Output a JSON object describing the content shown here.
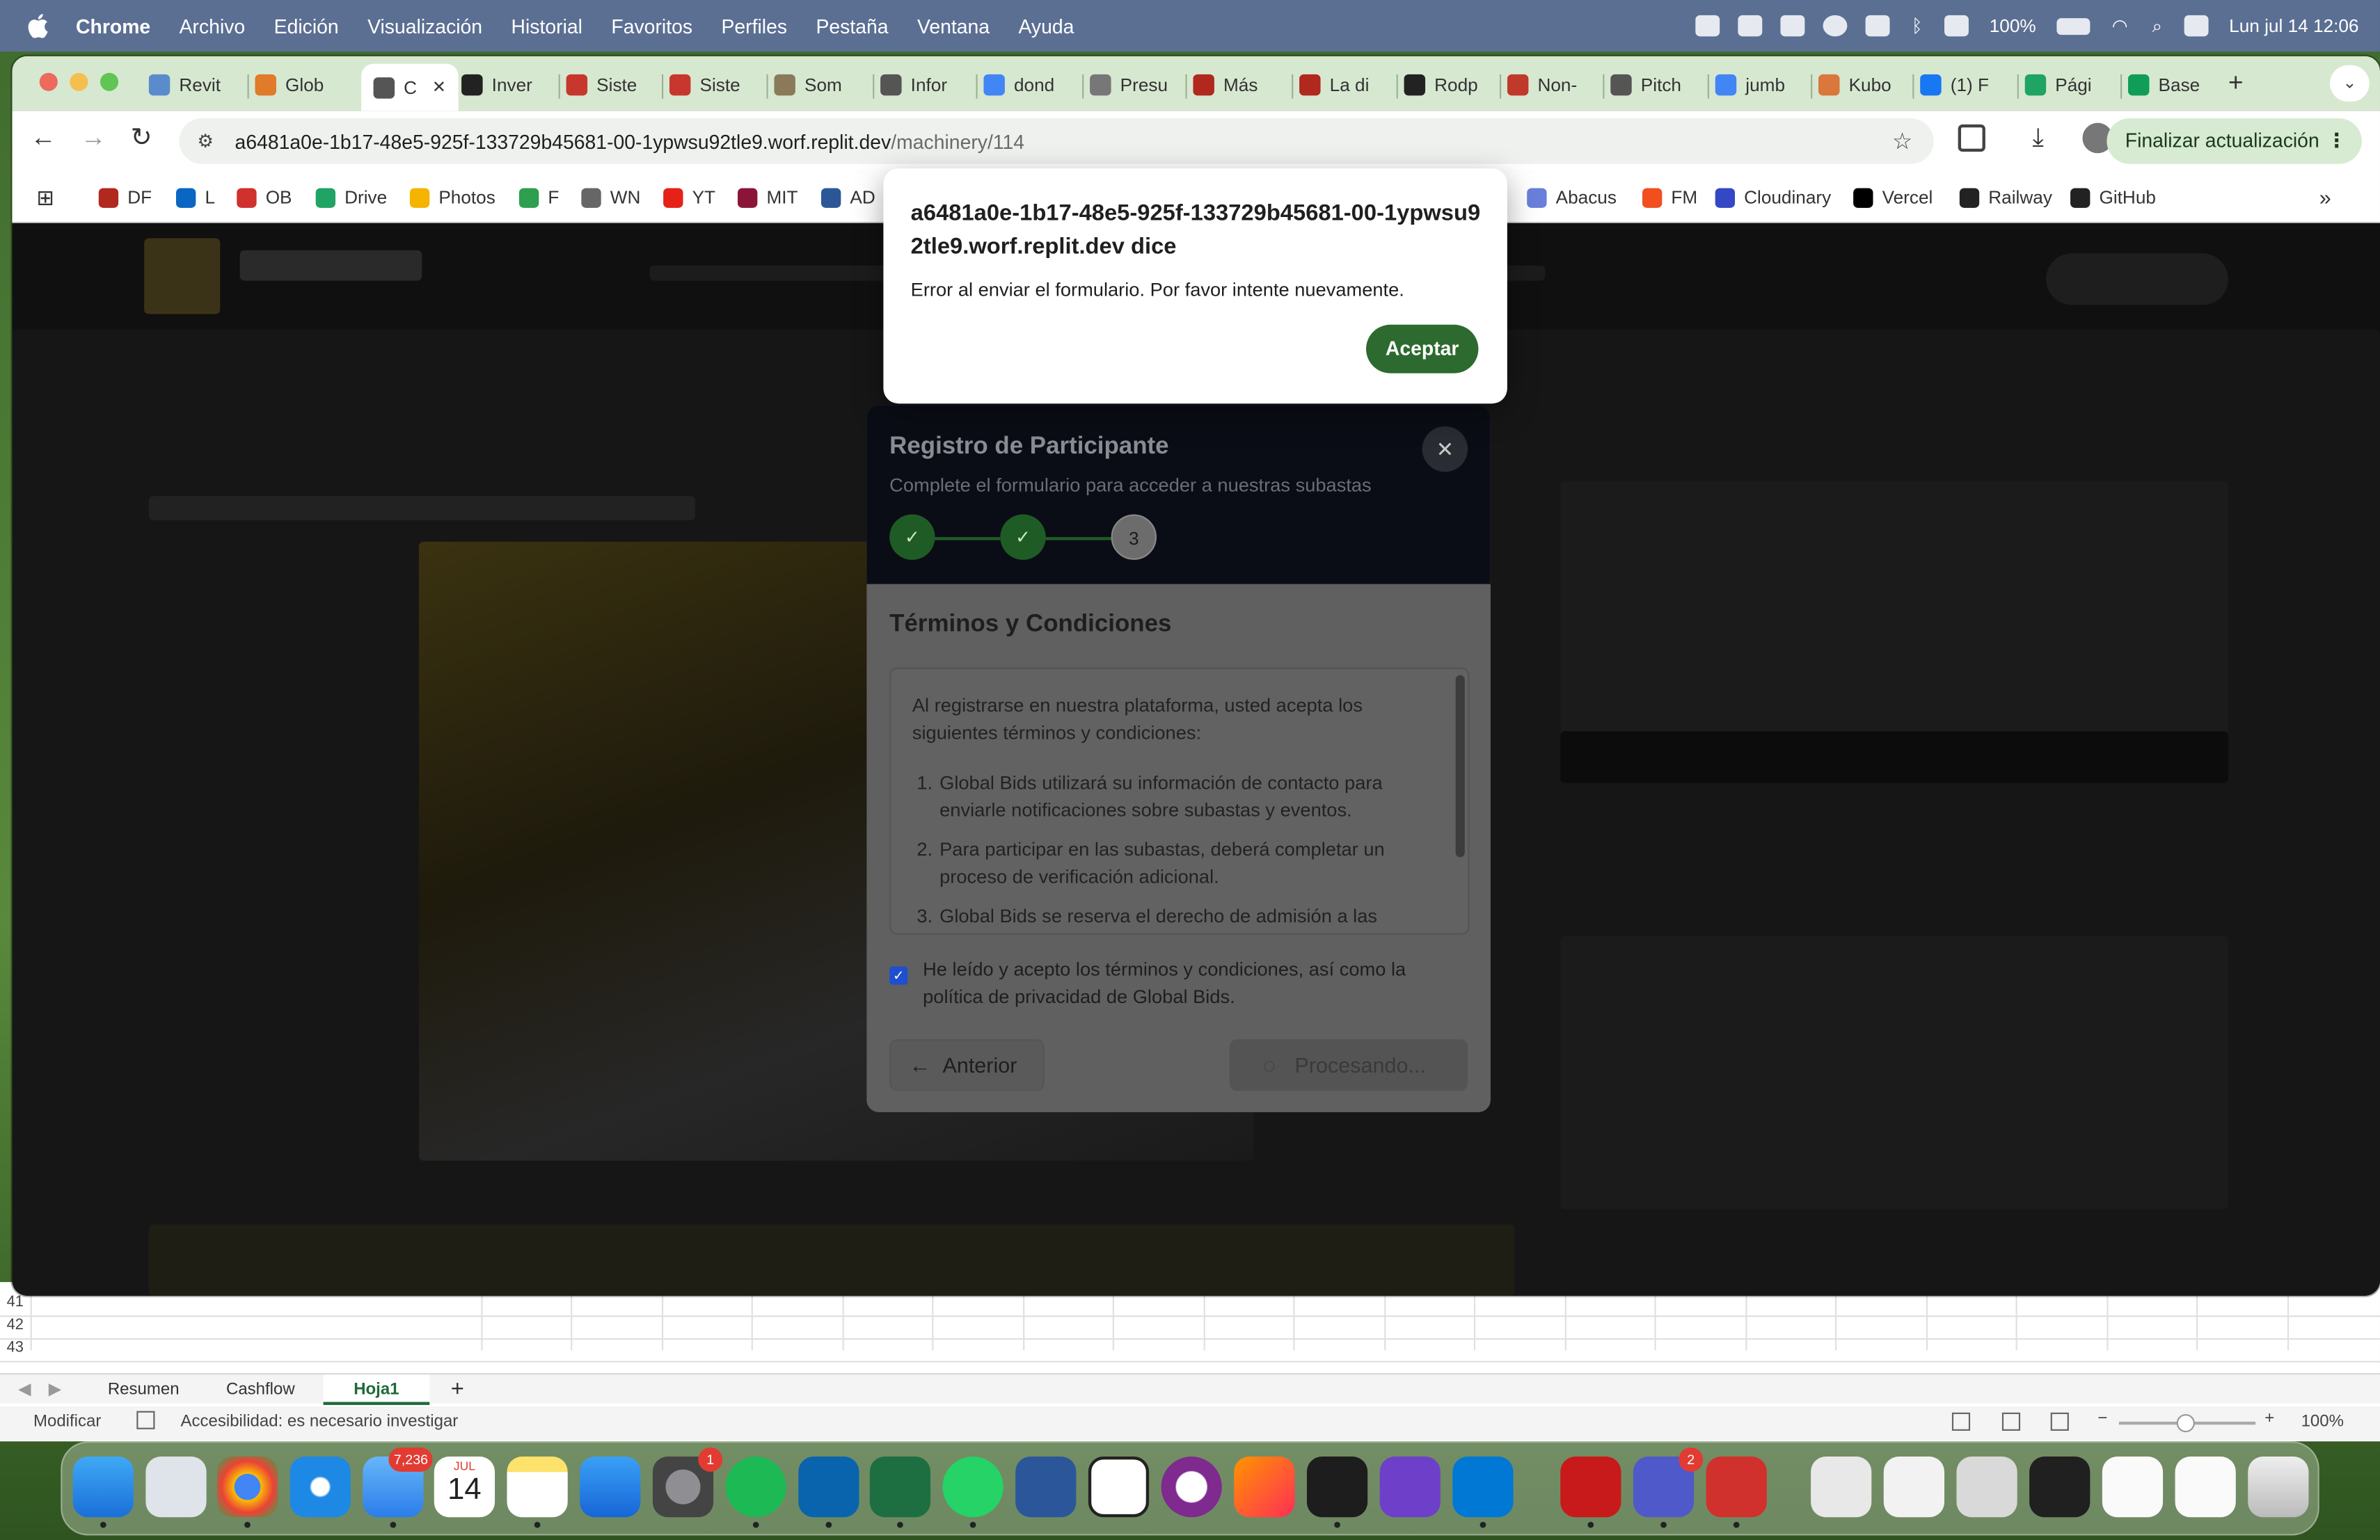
{
  "menubar": {
    "app": "Chrome",
    "items": [
      "Archivo",
      "Edición",
      "Visualización",
      "Historial",
      "Favoritos",
      "Perfiles",
      "Pestaña",
      "Ventana",
      "Ayuda"
    ],
    "battery": "100%",
    "clock": "Lun jul 14  12:06"
  },
  "tabs": [
    {
      "label": "Revit",
      "icon": "revit-icon",
      "color": "#5a8ccc"
    },
    {
      "label": "Glob",
      "icon": "global-bids-icon",
      "color": "#e07b2a"
    },
    {
      "label": "C",
      "icon": "globe-icon",
      "color": "#555555",
      "active": true
    },
    {
      "label": "Inver",
      "icon": "openai-icon",
      "color": "#222222"
    },
    {
      "label": "Siste",
      "icon": "flag-icon",
      "color": "#c8372d"
    },
    {
      "label": "Siste",
      "icon": "flag-icon",
      "color": "#c8372d"
    },
    {
      "label": "Som",
      "icon": "hat-icon",
      "color": "#8a7a5a"
    },
    {
      "label": "Infor",
      "icon": "globe-icon",
      "color": "#555555"
    },
    {
      "label": "dond",
      "icon": "google-icon",
      "color": "#4285f4"
    },
    {
      "label": "Presu",
      "icon": "loader-icon",
      "color": "#777777"
    },
    {
      "label": "Más",
      "icon": "df-icon",
      "color": "#b1281e"
    },
    {
      "label": "La di",
      "icon": "df-icon",
      "color": "#b1281e"
    },
    {
      "label": "Rodp",
      "icon": "github-icon",
      "color": "#222222"
    },
    {
      "label": "Non-",
      "icon": "r-icon",
      "color": "#c0392b"
    },
    {
      "label": "Pitch",
      "icon": "globe-icon",
      "color": "#555555"
    },
    {
      "label": "jumb",
      "icon": "google-icon",
      "color": "#4285f4"
    },
    {
      "label": "Kubo",
      "icon": "claude-icon",
      "color": "#d9773c"
    },
    {
      "label": "(1) F",
      "icon": "facebook-icon",
      "color": "#1877f2"
    },
    {
      "label": "Pági",
      "icon": "drive-icon",
      "color": "#1fa463"
    },
    {
      "label": "Base",
      "icon": "sheets-icon",
      "color": "#0f9d58"
    }
  ],
  "address": {
    "host": "a6481a0e-1b17-48e5-925f-133729b45681-00-1ypwsu92tle9.worf.replit.dev",
    "path": "/machinery/114"
  },
  "update_button": "Finalizar actualización",
  "bookmarks": [
    {
      "label": "DF",
      "color": "#b1281e"
    },
    {
      "label": "L",
      "color": "#0a66c2"
    },
    {
      "label": "OB",
      "color": "#d0312d"
    },
    {
      "label": "Drive",
      "color": "#1fa463"
    },
    {
      "label": "Photos",
      "color": "#f4b400"
    },
    {
      "label": "F",
      "color": "#2e9e4f"
    },
    {
      "label": "WN",
      "color": "#666666"
    },
    {
      "label": "YT",
      "color": "#e62117"
    },
    {
      "label": "MIT",
      "color": "#8a1538"
    },
    {
      "label": "AD",
      "color": "#2b5797"
    },
    {
      "label": "Abacus",
      "color": "#6a7fdb"
    },
    {
      "label": "FM",
      "color": "#f24e1e"
    },
    {
      "label": "Cloudinary",
      "color": "#3448c5"
    },
    {
      "label": "Vercel",
      "color": "#000000"
    },
    {
      "label": "Railway",
      "color": "#222222"
    },
    {
      "label": "GitHub",
      "color": "#222222"
    }
  ],
  "dialog": {
    "title": "a6481a0e-1b17-48e5-925f-133729b45681-00-1ypwsu92tle9.worf.replit.dev dice",
    "message": "Error al enviar el formulario. Por favor intente nuevamente.",
    "button": "Aceptar"
  },
  "modal": {
    "title": "Registro de Participante",
    "subtitle": "Complete el formulario para acceder a nuestras subastas",
    "step_current": "3",
    "section": "Términos y Condiciones",
    "intro": "Al registrarse en nuestra plataforma, usted acepta los siguientes términos y condiciones:",
    "terms": [
      {
        "n": "1.",
        "text": "Global Bids utilizará su información de contacto para enviarle notificaciones sobre subastas y eventos."
      },
      {
        "n": "2.",
        "text": "Para participar en las subastas, deberá completar un proceso de verificación adicional."
      },
      {
        "n": "3.",
        "text": "Global Bids se reserva el derecho de admisión a las subastas."
      }
    ],
    "accept_label": "He leído y acepto los términos y condiciones, así como la política de privacidad de Global Bids.",
    "accept_checked": true,
    "prev_button": "Anterior",
    "submit_button": "Procesando..."
  },
  "excel": {
    "rows": [
      "41",
      "42",
      "43"
    ],
    "sheets": [
      "Resumen",
      "Cashflow",
      "Hoja1"
    ],
    "status_mode": "Modificar",
    "accessibility": "Accesibilidad: es necesario investigar",
    "zoom": "100%"
  },
  "dock": {
    "mail_badge": "7,236",
    "calendar_month": "JUL",
    "calendar_day": "14",
    "settings_badge": "1",
    "teams_badge": "2"
  }
}
